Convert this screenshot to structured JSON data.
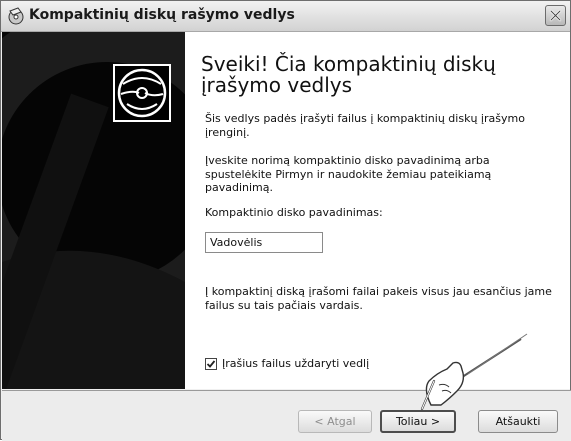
{
  "window": {
    "title": "Kompaktinių diskų rašymo vedlys"
  },
  "content": {
    "heading": "Sveiki! Čia kompaktinių diskų įrašymo vedlys",
    "intro": "Šis vedlys padės įrašyti failus į kompaktinių diskų įrašymo įrenginį.",
    "instructions": "Įveskite norimą kompaktinio disko pavadinimą arba spustelėkite Pirmyn ir naudokite žemiau pateikiamą pavadinimą.",
    "name_label": "Kompaktinio disko pavadinimas:",
    "name_value": "Vadovėlis",
    "warning": "Į kompaktinį diską įrašomi failai pakeis visus jau esančius jame failus su tais pačiais vardais.",
    "close_checkbox_label": "Įrašius failus uždaryti vedlį",
    "close_checkbox_checked": true
  },
  "buttons": {
    "back": "< Atgal",
    "next": "Toliau >",
    "cancel": "Atšaukti"
  },
  "icons": {
    "title": "cd-writer-icon",
    "close": "close-icon",
    "banner": "cd-disc-icon",
    "pointer": "hand-pointer-icon"
  }
}
